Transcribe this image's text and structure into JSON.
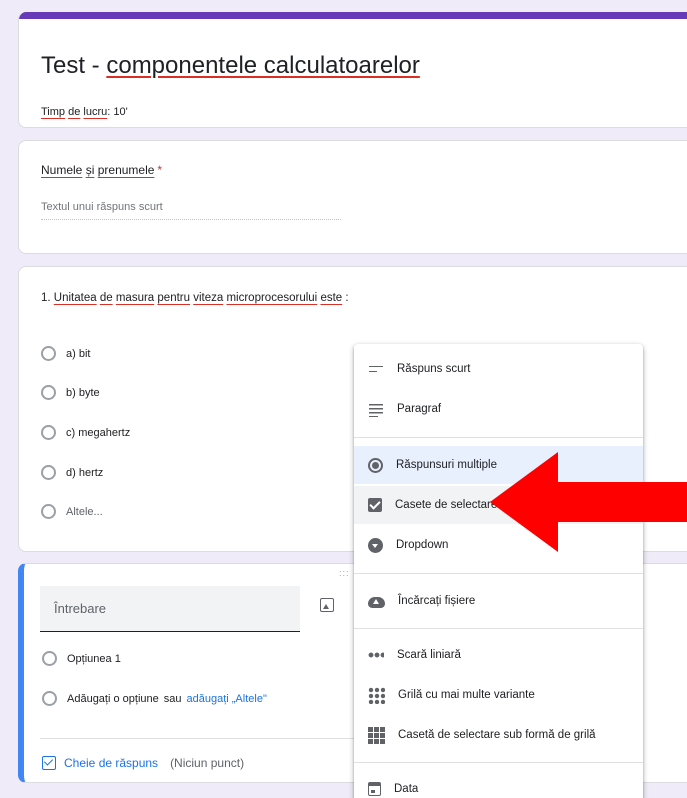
{
  "form": {
    "title_prefix": "Test - ",
    "title_rest": "componentele calculatoarelor",
    "description_a": "Timp",
    "description_b": "de",
    "description_c": "lucru",
    "description_d": ": 10'"
  },
  "name_question": {
    "label_a": "Numele",
    "label_b": "și",
    "label_c": "prenumele",
    "required_mark": "*",
    "placeholder": "Textul unui răspuns scurt"
  },
  "question1": {
    "number": "1.",
    "text_words": [
      "Unitatea",
      "de",
      "masura",
      "pentru",
      "viteza",
      "microprocesorului",
      "este"
    ],
    "text_end": " :",
    "options": [
      "a) bit",
      "b) byte",
      "c)  megahertz",
      "d)  hertz"
    ],
    "other_option": "Altele..."
  },
  "new_question": {
    "question_placeholder": "Întrebare",
    "option1": "Opțiunea 1",
    "add_option": "Adăugați o opțiune",
    "or_text": "sau",
    "add_other": "adăugați „Altele\"",
    "answer_key": "Cheie de răspuns",
    "points": "(Niciun punct)",
    "drag_handle": ":::"
  },
  "type_menu": {
    "items": [
      {
        "label": "Răspuns scurt",
        "icon": "short-answer-icon"
      },
      {
        "label": "Paragraf",
        "icon": "paragraph-icon"
      },
      {
        "label": "Răspunsuri multiple",
        "icon": "multiple-choice-icon",
        "state": "selected"
      },
      {
        "label": "Casete de selectare",
        "icon": "checkbox-icon",
        "state": "hover"
      },
      {
        "label": "Dropdown",
        "icon": "dropdown-icon"
      },
      {
        "label": "Încărcați fișiere",
        "icon": "upload-icon"
      },
      {
        "label": "Scară liniară",
        "icon": "linear-scale-icon"
      },
      {
        "label": "Grilă cu mai multe variante",
        "icon": "grid-icon"
      },
      {
        "label": "Casetă de selectare sub formă de grilă",
        "icon": "checkbox-grid-icon"
      },
      {
        "label": "Data",
        "icon": "date-icon"
      }
    ]
  },
  "colors": {
    "accent": "#673ab7",
    "blue": "#1a73e8",
    "arrow": "#ff0000",
    "required": "#d93025"
  }
}
